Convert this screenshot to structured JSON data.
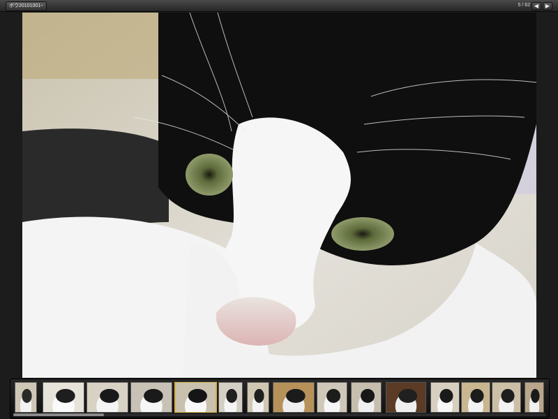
{
  "window": {
    "album_title": "ボウ20101001~",
    "counter": "5 / 62",
    "prev_icon": "arrow-left",
    "next_icon": "arrow-right"
  },
  "viewer": {
    "photo_subject": "black-and-white cat close-up",
    "selected_index": 4
  },
  "filmstrip": {
    "thumbnails": [
      {
        "colors": [
          "#cfc7b6",
          "#2a2a2a",
          "#f2f2f2"
        ]
      },
      {
        "colors": [
          "#e7e3da",
          "#1e1e1e",
          "#fafafa"
        ]
      },
      {
        "colors": [
          "#d8d2c5",
          "#191919",
          "#f4f4f4"
        ]
      },
      {
        "colors": [
          "#c8c2b6",
          "#1a1a1a",
          "#f6f6f6"
        ]
      },
      {
        "colors": [
          "#c9c1ae",
          "#151515",
          "#f7f7f7"
        ]
      },
      {
        "colors": [
          "#d4cfc5",
          "#202020",
          "#f5f5f5"
        ]
      },
      {
        "colors": [
          "#d0c7b3",
          "#1f1f1f",
          "#f3f3f3"
        ]
      },
      {
        "colors": [
          "#b6925a",
          "#1b1b1b",
          "#eeeeee"
        ]
      },
      {
        "colors": [
          "#cfc8b8",
          "#1c1c1c",
          "#f5f5f5"
        ]
      },
      {
        "colors": [
          "#c6bfae",
          "#181818",
          "#f0f0f0"
        ]
      },
      {
        "colors": [
          "#5b3b26",
          "#202020",
          "#efefef"
        ]
      },
      {
        "colors": [
          "#d7d0c0",
          "#1a1a1a",
          "#f7f7f7"
        ]
      },
      {
        "colors": [
          "#c9b690",
          "#1c1c1c",
          "#f3f3f3"
        ]
      },
      {
        "colors": [
          "#ccbfa5",
          "#1e1e1e",
          "#f2f2f2"
        ]
      },
      {
        "colors": [
          "#b9a68a",
          "#1a1a1a",
          "#f0f0f0"
        ]
      }
    ],
    "scroll_fraction": 0.17
  },
  "colors": {
    "selected_border": "#d8b04a"
  }
}
